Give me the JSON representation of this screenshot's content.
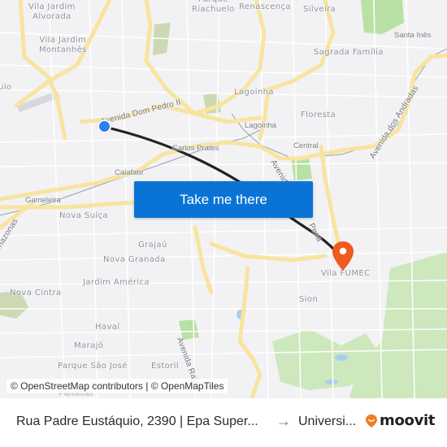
{
  "map": {
    "neighborhood_labels": [
      {
        "text": "Vila Jardim\nAlvorada"
      },
      {
        "text": "Vila Jardim\nMontanhês"
      },
      {
        "text": "Parque\nRiachuelo"
      },
      {
        "text": "Renascença"
      },
      {
        "text": "Silveira"
      },
      {
        "text": "Sagrada Família"
      },
      {
        "text": "Santa Inês"
      },
      {
        "text": "Lagoinha"
      },
      {
        "text": "Floresta"
      },
      {
        "text": "Lagoinha"
      },
      {
        "text": "Central"
      },
      {
        "text": "Carlos Prates"
      },
      {
        "text": "Calafate"
      },
      {
        "text": "Gameleira"
      },
      {
        "text": "Nova Suíça"
      },
      {
        "text": "Grajaú"
      },
      {
        "text": "Nova Granada"
      },
      {
        "text": "Jardim América"
      },
      {
        "text": "Nova Cintra"
      },
      {
        "text": "Havaí"
      },
      {
        "text": "Marajó"
      },
      {
        "text": "Parque São José"
      },
      {
        "text": "Estoril"
      },
      {
        "text": "Sion"
      },
      {
        "text": "Vila FUMEC"
      },
      {
        "text": "uio"
      },
      {
        "text": "Palmeiras"
      }
    ],
    "road_labels": [
      {
        "text": "Avenida Dom Pedro II"
      },
      {
        "text": "Avenida dos Andradas"
      },
      {
        "text": "Avenida"
      },
      {
        "text": "Pena"
      },
      {
        "text": "Avenida Raja"
      },
      {
        "text": "mazonas"
      }
    ],
    "route": {
      "color": "#222222"
    },
    "origin_marker": {
      "color": "#2f7ff0"
    },
    "destination_marker": {
      "color": "#ef5a1e"
    }
  },
  "cta": {
    "label": "Take me there",
    "color": "#0a74d6"
  },
  "attribution": "© OpenStreetMap contributors | © OpenMapTiles",
  "footer": {
    "from": "Rua Padre Eustáquio, 2390 | Epa Super...",
    "arrow": "→",
    "to": "Universi...",
    "brand": "moovit",
    "brand_color": "#f27b23"
  }
}
